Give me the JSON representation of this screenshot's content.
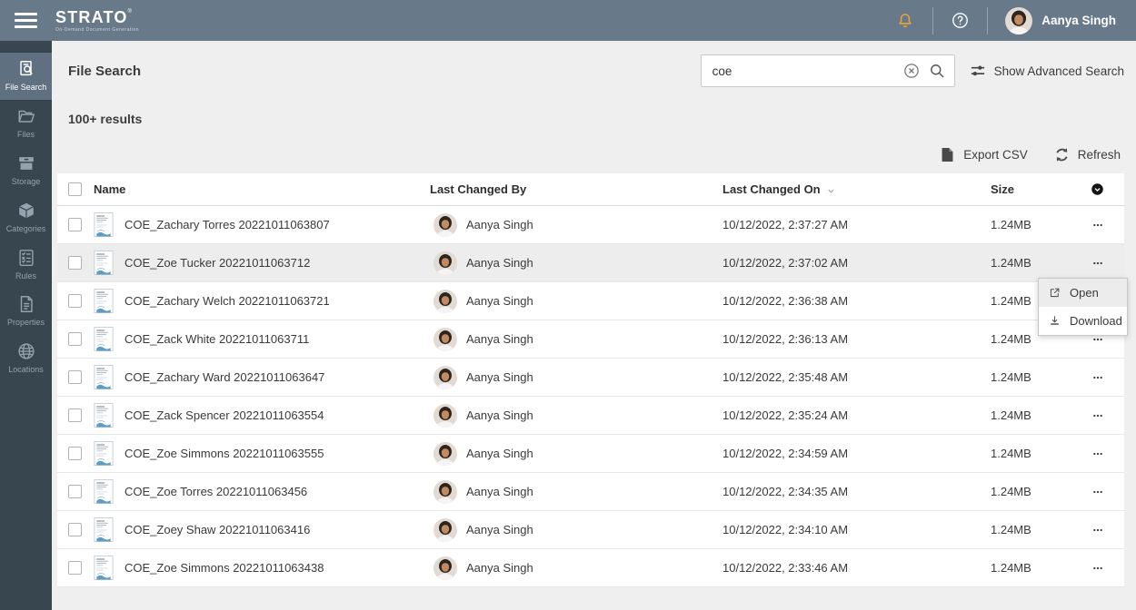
{
  "topbar": {
    "logo": "STRATO",
    "logo_mark": "®",
    "tagline": "On-Demand Document Generation",
    "user_name": "Aanya Singh"
  },
  "icons": {
    "menu": "hamburger-icon",
    "notifications": "bell-icon",
    "help": "question-circle-icon",
    "search": "magnifier-icon",
    "clear_search": "circled-x-icon",
    "advanced_search": "sliders-icon",
    "export": "file-icon",
    "refresh": "sync-icon",
    "sort": "chevron-down-icon",
    "column_options": "circle-chevron-icon",
    "row_more": "ellipsis-icon",
    "open": "external-link-icon",
    "download": "download-icon",
    "file_thumbnail": "document-preview-icon"
  },
  "sidebar": {
    "items": [
      {
        "id": "file-search",
        "label": "File Search",
        "icon": "file-search",
        "active": true
      },
      {
        "id": "files",
        "label": "Files",
        "icon": "files",
        "active": false
      },
      {
        "id": "storage",
        "label": "Storage",
        "icon": "storage",
        "active": false
      },
      {
        "id": "categories",
        "label": "Categories",
        "icon": "categories",
        "active": false
      },
      {
        "id": "rules",
        "label": "Rules",
        "icon": "rules",
        "active": false
      },
      {
        "id": "properties",
        "label": "Properties",
        "icon": "properties",
        "active": false
      },
      {
        "id": "locations",
        "label": "Locations",
        "icon": "locations",
        "active": false
      }
    ]
  },
  "header": {
    "title": "File Search",
    "search_value": "coe",
    "advanced_search_label": "Show Advanced Search"
  },
  "results_count": "100+ results",
  "toolbar": {
    "export_label": "Export CSV",
    "refresh_label": "Refresh"
  },
  "table": {
    "columns": {
      "name": "Name",
      "changed_by": "Last Changed By",
      "changed_on": "Last Changed On",
      "size": "Size"
    },
    "sorted_by": "changed_on",
    "sort_direction": "desc",
    "rows": [
      {
        "name": "COE_Zachary Torres 20221011063807",
        "changed_by": "Aanya Singh",
        "changed_on": "10/12/2022, 2:37:27 AM",
        "size": "1.24MB",
        "highlighted": false
      },
      {
        "name": "COE_Zoe Tucker 20221011063712",
        "changed_by": "Aanya Singh",
        "changed_on": "10/12/2022, 2:37:02 AM",
        "size": "1.24MB",
        "highlighted": true
      },
      {
        "name": "COE_Zachary Welch 20221011063721",
        "changed_by": "Aanya Singh",
        "changed_on": "10/12/2022, 2:36:38 AM",
        "size": "1.24MB",
        "highlighted": false
      },
      {
        "name": "COE_Zack White 20221011063711",
        "changed_by": "Aanya Singh",
        "changed_on": "10/12/2022, 2:36:13 AM",
        "size": "1.24MB",
        "highlighted": false
      },
      {
        "name": "COE_Zachary Ward 20221011063647",
        "changed_by": "Aanya Singh",
        "changed_on": "10/12/2022, 2:35:48 AM",
        "size": "1.24MB",
        "highlighted": false
      },
      {
        "name": "COE_Zack Spencer 20221011063554",
        "changed_by": "Aanya Singh",
        "changed_on": "10/12/2022, 2:35:24 AM",
        "size": "1.24MB",
        "highlighted": false
      },
      {
        "name": "COE_Zoe Simmons 20221011063555",
        "changed_by": "Aanya Singh",
        "changed_on": "10/12/2022, 2:34:59 AM",
        "size": "1.24MB",
        "highlighted": false
      },
      {
        "name": "COE_Zoe Torres 20221011063456",
        "changed_by": "Aanya Singh",
        "changed_on": "10/12/2022, 2:34:35 AM",
        "size": "1.24MB",
        "highlighted": false
      },
      {
        "name": "COE_Zoey Shaw 20221011063416",
        "changed_by": "Aanya Singh",
        "changed_on": "10/12/2022, 2:34:10 AM",
        "size": "1.24MB",
        "highlighted": false
      },
      {
        "name": "COE_Zoe Simmons 20221011063438",
        "changed_by": "Aanya Singh",
        "changed_on": "10/12/2022, 2:33:46 AM",
        "size": "1.24MB",
        "highlighted": false
      }
    ]
  },
  "context_menu": {
    "items": [
      {
        "label": "Open",
        "icon": "open",
        "highlighted": true
      },
      {
        "label": "Download",
        "icon": "download",
        "highlighted": false
      }
    ]
  },
  "colors": {
    "topbar": "#68798a",
    "sidebar": "#37464f",
    "sidebar_active": "#5f7180",
    "bell": "#e8a23c",
    "page_bg": "#efefef",
    "row_highlight": "#ededed"
  }
}
